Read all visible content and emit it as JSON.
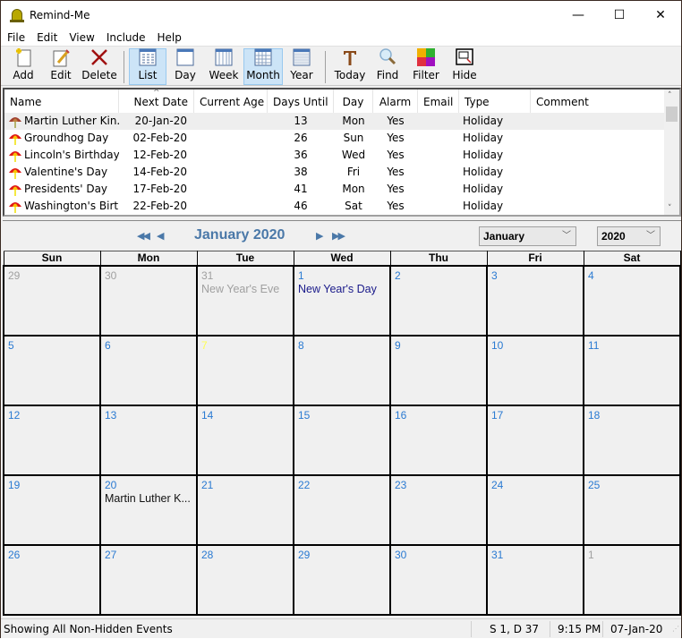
{
  "window": {
    "title": "Remind-Me",
    "controls": {
      "minimize": "—",
      "maximize": "☐",
      "close": "✕"
    }
  },
  "menu": [
    "File",
    "Edit",
    "View",
    "Include",
    "Help"
  ],
  "toolbar": {
    "buttons": [
      {
        "label": "Add",
        "icon": "add-document-icon"
      },
      {
        "label": "Edit",
        "icon": "pencil-icon"
      },
      {
        "label": "Delete",
        "icon": "delete-x-icon"
      },
      {
        "label": "List",
        "icon": "list-view-icon",
        "active": true
      },
      {
        "label": "Day",
        "icon": "day-view-icon"
      },
      {
        "label": "Week",
        "icon": "week-view-icon"
      },
      {
        "label": "Month",
        "icon": "month-view-icon",
        "active": true
      },
      {
        "label": "Year",
        "icon": "year-view-icon"
      },
      {
        "label": "Today",
        "icon": "today-t-icon"
      },
      {
        "label": "Find",
        "icon": "magnifier-icon"
      },
      {
        "label": "Filter",
        "icon": "filter-color-grid-icon"
      },
      {
        "label": "Hide",
        "icon": "hide-window-icon"
      }
    ]
  },
  "list": {
    "columns": [
      "Name",
      "Next Date",
      "Current Age",
      "Days Until",
      "Day",
      "Alarm",
      "Email",
      "Type",
      "Comment"
    ],
    "sort_indicator": "^",
    "rows": [
      {
        "name": "Martin Luther Kin...",
        "next_date": "20-Jan-20",
        "current_age": "",
        "days_until": "13",
        "day": "Mon",
        "alarm": "Yes",
        "email": "",
        "type": "Holiday",
        "comment": "",
        "selected": true
      },
      {
        "name": "Groundhog Day",
        "next_date": "02-Feb-20",
        "current_age": "",
        "days_until": "26",
        "day": "Sun",
        "alarm": "Yes",
        "email": "",
        "type": "Holiday",
        "comment": ""
      },
      {
        "name": "Lincoln's Birthday",
        "next_date": "12-Feb-20",
        "current_age": "",
        "days_until": "36",
        "day": "Wed",
        "alarm": "Yes",
        "email": "",
        "type": "Holiday",
        "comment": ""
      },
      {
        "name": "Valentine's Day",
        "next_date": "14-Feb-20",
        "current_age": "",
        "days_until": "38",
        "day": "Fri",
        "alarm": "Yes",
        "email": "",
        "type": "Holiday",
        "comment": ""
      },
      {
        "name": "Presidents' Day",
        "next_date": "17-Feb-20",
        "current_age": "",
        "days_until": "41",
        "day": "Mon",
        "alarm": "Yes",
        "email": "",
        "type": "Holiday",
        "comment": ""
      },
      {
        "name": "Washington's Birt...",
        "next_date": "22-Feb-20",
        "current_age": "",
        "days_until": "46",
        "day": "Sat",
        "alarm": "Yes",
        "email": "",
        "type": "Holiday",
        "comment": ""
      }
    ]
  },
  "calendar": {
    "title": "January 2020",
    "nav": {
      "prev_year": "◀◀",
      "prev_month": "◀",
      "next_month": "▶",
      "next_year": "▶▶"
    },
    "month_select": "January",
    "year_select": "2020",
    "weekdays": [
      "Sun",
      "Mon",
      "Tue",
      "Wed",
      "Thu",
      "Fri",
      "Sat"
    ],
    "weeks": [
      [
        {
          "d": "29",
          "other": true
        },
        {
          "d": "30",
          "other": true
        },
        {
          "d": "31",
          "other": true,
          "events": [
            {
              "text": "New Year's Eve",
              "style": "grey"
            }
          ]
        },
        {
          "d": "1",
          "events": [
            {
              "text": "New Year's Day",
              "style": "navy"
            }
          ]
        },
        {
          "d": "2"
        },
        {
          "d": "3"
        },
        {
          "d": "4"
        }
      ],
      [
        {
          "d": "5"
        },
        {
          "d": "6"
        },
        {
          "d": "7",
          "today": true
        },
        {
          "d": "8"
        },
        {
          "d": "9"
        },
        {
          "d": "10"
        },
        {
          "d": "11"
        }
      ],
      [
        {
          "d": "12"
        },
        {
          "d": "13"
        },
        {
          "d": "14"
        },
        {
          "d": "15"
        },
        {
          "d": "16"
        },
        {
          "d": "17"
        },
        {
          "d": "18"
        }
      ],
      [
        {
          "d": "19"
        },
        {
          "d": "20",
          "events": [
            {
              "text": "Martin Luther K...",
              "style": "black"
            }
          ]
        },
        {
          "d": "21"
        },
        {
          "d": "22"
        },
        {
          "d": "23"
        },
        {
          "d": "24"
        },
        {
          "d": "25"
        }
      ],
      [
        {
          "d": "26"
        },
        {
          "d": "27"
        },
        {
          "d": "28"
        },
        {
          "d": "29"
        },
        {
          "d": "30"
        },
        {
          "d": "31"
        },
        {
          "d": "1",
          "other": true
        }
      ]
    ]
  },
  "status": {
    "message": "Showing All Non-Hidden Events",
    "position": "S 1, D 37",
    "time": "9:15 PM",
    "date": "07-Jan-20"
  },
  "colors": {
    "accent_blue": "#4a78a8",
    "day_number": "#2a7ad2",
    "today_bg": "#a0a0a0",
    "today_number": "#ffff50",
    "active_tool": "#cce4f7"
  }
}
